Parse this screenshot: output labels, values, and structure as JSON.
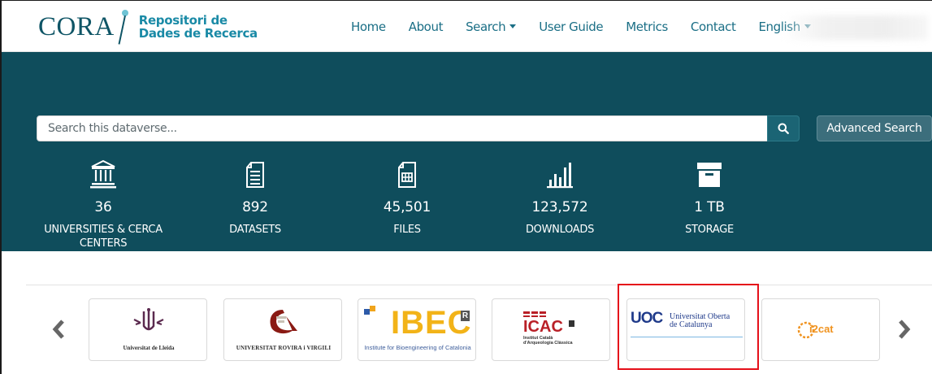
{
  "header": {
    "brand": {
      "name": "CORA",
      "subtitle_line1": "Repositori de",
      "subtitle_line2": "Dades de Recerca"
    },
    "nav": [
      {
        "label": "Home",
        "dropdown": false
      },
      {
        "label": "About",
        "dropdown": false
      },
      {
        "label": "Search",
        "dropdown": true
      },
      {
        "label": "User Guide",
        "dropdown": false
      },
      {
        "label": "Metrics",
        "dropdown": false
      },
      {
        "label": "Contact",
        "dropdown": false
      },
      {
        "label": "English",
        "dropdown": true
      }
    ]
  },
  "search": {
    "placeholder": "Search this dataverse...",
    "advanced_label": "Advanced Search",
    "button_icon": "search-icon"
  },
  "stats": [
    {
      "icon": "university-icon",
      "value": "36",
      "label": "UNIVERSITIES & CERCA CENTERS"
    },
    {
      "icon": "document-icon",
      "value": "892",
      "label": "DATASETS"
    },
    {
      "icon": "file-table-icon",
      "value": "45,501",
      "label": "FILES"
    },
    {
      "icon": "bar-chart-icon",
      "value": "123,572",
      "label": "DOWNLOADS"
    },
    {
      "icon": "archive-box-icon",
      "value": "1 TB",
      "label": "STORAGE"
    }
  ],
  "carousel": {
    "prev_icon": "chevron-left-icon",
    "next_icon": "chevron-right-icon",
    "logos": [
      {
        "name": "Universitat de Lleida",
        "caption": "Universitat de Lleida"
      },
      {
        "name": "Universitat Rovira i Virgili",
        "caption": "UNIVERSITAT ROVIRA i VIRGILI"
      },
      {
        "name": "IBEC",
        "wordmark": "IBEC",
        "badge": "R",
        "caption": "Institute for Bioengineering of Catalonia"
      },
      {
        "name": "ICAC",
        "wordmark": "ICAC",
        "caption_line1": "Institut Català",
        "caption_line2": "d'Arqueologia Clàssica"
      },
      {
        "name": "UOC",
        "wordmark": "UOC",
        "caption_line1": "Universitat Oberta",
        "caption_line2": "de Catalunya",
        "highlighted": true
      },
      {
        "name": "i2cat",
        "wordmark": "i2cat"
      }
    ]
  },
  "colors": {
    "brand": "#0f5566",
    "hero_bg": "#0f4d5c",
    "link": "#1b6f86",
    "highlight": "#e5101a"
  }
}
